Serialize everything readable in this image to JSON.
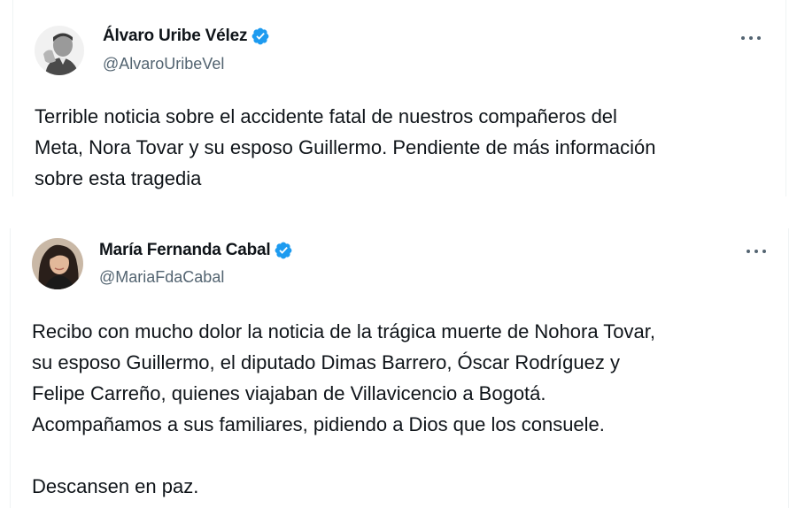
{
  "tweets": [
    {
      "name": "Álvaro Uribe Vélez",
      "handle": "@AlvaroUribeVel",
      "verified": true,
      "avatar_icon": "grayscale-portrait-hand-on-chin",
      "more_icon": "more-horizontal-icon",
      "text_lines": [
        "Terrible noticia sobre el accidente fatal de nuestros compañeros del",
        "Meta, Nora Tovar y su esposo Guillermo. Pendiente de más información",
        "sobre esta tragedia"
      ]
    },
    {
      "name": "María Fernanda Cabal",
      "handle": "@MariaFdaCabal",
      "verified": true,
      "avatar_icon": "portrait-woman-dark-hair",
      "more_icon": "more-horizontal-icon",
      "text_lines": [
        "Recibo con mucho dolor la noticia de la trágica muerte de Nohora Tovar,",
        "su esposo Guillermo, el diputado Dimas Barrero, Óscar Rodríguez y",
        "Felipe Carreño, quienes viajaban de Villavicencio a Bogotá.",
        "Acompañamos a sus familiares, pidiendo a Dios que los consuele."
      ],
      "closing_line": "Descansen en paz."
    }
  ],
  "colors": {
    "verified_badge": "#1d9bf0",
    "text_primary": "#0f1419",
    "text_secondary": "#536471",
    "border": "#eff3f4"
  }
}
